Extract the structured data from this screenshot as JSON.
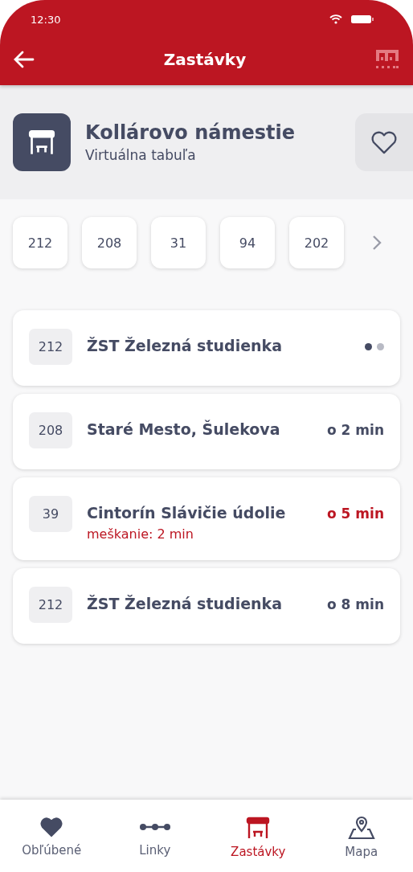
{
  "status_bar": {
    "time": "12:30"
  },
  "header": {
    "title": "Zastávky"
  },
  "stop": {
    "name": "Kollárovo námestie",
    "subtitle": "Virtuálna tabuľa",
    "favorite": false
  },
  "lines": [
    "212",
    "208",
    "31",
    "94",
    "202"
  ],
  "departures": [
    {
      "kind": "loading",
      "line": "212",
      "destination": "ŽST Železná studienka"
    },
    {
      "kind": "time",
      "line": "208",
      "destination": "Staré Mesto, Šulekova",
      "time": "o 2 min",
      "delayed": false
    },
    {
      "kind": "time",
      "line": "39",
      "destination": "Cintorín Slávičie údolie",
      "time": "o 5 min",
      "delayed": true,
      "delay": "meškanie: 2 min"
    },
    {
      "kind": "time",
      "line": "212",
      "destination": "ŽST Železná studienka",
      "time": "o 8 min",
      "delayed": false
    }
  ],
  "nav": [
    {
      "label": "Obľúbené",
      "selected": false
    },
    {
      "label": "Linky",
      "selected": false
    },
    {
      "label": "Zastávky",
      "selected": true
    },
    {
      "label": "Mapa",
      "selected": false
    }
  ]
}
